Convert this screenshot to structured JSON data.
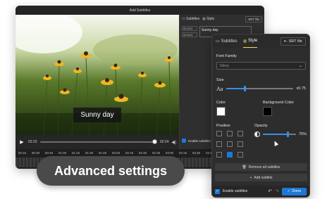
{
  "editor": {
    "title": "Add Subtitles",
    "caption": "Sunny day",
    "current_time": "02:23",
    "total_time": "02:24",
    "ruler_ticks": [
      "00:15",
      "00:30",
      "00:45",
      "01:00",
      "01:15",
      "01:30",
      "01:45",
      "02:00",
      "02:15",
      "02:30",
      "02:45",
      "03:00",
      "03:15",
      "03:30",
      "03:45",
      "04:00",
      "04:15",
      "04:30"
    ],
    "side_tab_subtitles": "Subtitles",
    "side_tab_style": "Style",
    "side_srt": "SRT file",
    "sub_start": "02:23.0",
    "sub_end": "02:24.0",
    "sub_text": "Sunny day",
    "enable_label": "Enable subtitles"
  },
  "badge": {
    "text": "Advanced settings"
  },
  "panel": {
    "tab_subtitles": "Subtitles",
    "tab_style": "Style",
    "srt_button": "SRT file",
    "font_family_label": "Font Family",
    "font_value": "Gilroy",
    "size_label": "Size",
    "size_icon": "Aa",
    "size_value": "x0.75",
    "size_fraction": 0.28,
    "color_label": "Color",
    "color_value": "#ffffff",
    "bg_color_label": "Background Color",
    "bg_color_value": "#000000",
    "position_label": "Position",
    "position_selected": 7,
    "opacity_label": "Opacity",
    "opacity_value": "75%",
    "opacity_fraction": 0.75,
    "remove_all": "Remove all subtitles",
    "add_subtitle": "Add subtitle",
    "enable_label": "Enable subtitles",
    "done": "Done",
    "accent_color": "#1e78d6",
    "style_tab_color": "#ffd766"
  }
}
